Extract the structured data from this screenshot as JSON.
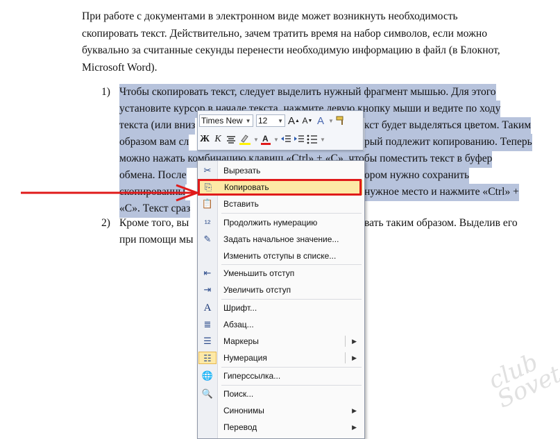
{
  "intro": [
    "При работе с документами в электронном виде может возникнуть необходимость",
    "скопировать текст. Действительно, зачем тратить время на набор символов, если можно",
    "буквально за считанные секунды перенести необходимую информацию в файл (в Блокнот,",
    "Microsoft Word)."
  ],
  "list": {
    "item1_num": "1)",
    "item1_lines": [
      "Чтобы скопировать текст, следует выделить нужный фрагмент мышью. Для этого",
      "установите курсор в начале текста, нажмите левую кнопку мыши и ведите по ходу",
      "текста (или вниз",
      "кст будет выделяться цветом. Таким",
      "образом вам сл",
      "рый подлежит копированию. Теперь",
      "можно нажать комбинацию клавиш «Ctrl» + «C», чтобы поместить текст в буфер",
      "обмена. После",
      "ором нужно сохранить",
      "скопированны",
      "нужное место и нажмите «Ctrl» +",
      "«C». Текст сраз"
    ],
    "item2_num": "2)",
    "item2_lines": [
      "Кроме того, вы",
      "вать таким образом. Выделив его",
      "при помощи мы"
    ]
  },
  "mini_toolbar": {
    "font": "Times New",
    "size": "12",
    "grow": "A",
    "shrink": "A",
    "styles": "A",
    "bold": "Ж",
    "italic": "К"
  },
  "menu": [
    {
      "label": "Вырезать",
      "icon": "scissors-icon",
      "highlighted": false
    },
    {
      "label": "Копировать",
      "icon": "copy-icon",
      "highlighted": true
    },
    {
      "label": "Вставить",
      "icon": "paste-icon",
      "highlighted": false
    },
    {
      "label": "Продолжить нумерацию",
      "icon": "continue-numbering-icon"
    },
    {
      "label": "Задать начальное значение...",
      "icon": "set-value-icon"
    },
    {
      "label": "Изменить отступы в списке...",
      "icon": ""
    },
    {
      "label": "Уменьшить отступ",
      "icon": "decrease-indent-icon"
    },
    {
      "label": "Увеличить отступ",
      "icon": "increase-indent-icon"
    },
    {
      "label": "Шрифт...",
      "icon": "font-icon"
    },
    {
      "label": "Абзац...",
      "icon": "paragraph-icon"
    },
    {
      "label": "Маркеры",
      "icon": "bullets-icon",
      "submenu": true
    },
    {
      "label": "Нумерация",
      "icon": "numbering-icon",
      "submenu": true
    },
    {
      "label": "Гиперссылка...",
      "icon": "hyperlink-icon"
    },
    {
      "label": "Поиск...",
      "icon": "search-icon"
    },
    {
      "label": "Синонимы",
      "icon": "",
      "submenu": true
    },
    {
      "label": "Перевод",
      "icon": "",
      "submenu": true
    }
  ],
  "colors": {
    "selection": "#b7c3dc",
    "highlight": "#fde9a6",
    "callout": "#e01a1a"
  },
  "watermark": "club Sovet"
}
